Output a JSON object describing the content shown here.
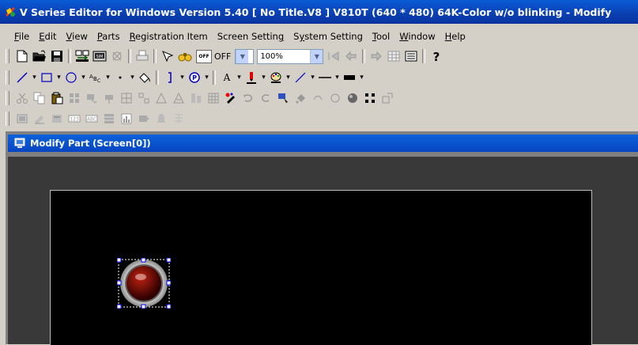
{
  "window": {
    "title": "V Series Editor for Windows Version 5.40 [ No Title.V8 ] V810T (640 * 480) 64K-Color w/o blinking - Modify"
  },
  "menu": [
    {
      "label": "File",
      "key": "F",
      "rest": "ile"
    },
    {
      "label": "Edit",
      "key": "E",
      "rest": "dit"
    },
    {
      "label": "View",
      "key": "V",
      "rest": "iew"
    },
    {
      "label": "Parts",
      "key": "P",
      "rest": "arts"
    },
    {
      "label": "Registration Item",
      "key": "R",
      "rest": "egistration Item"
    },
    {
      "label": "Screen Setting",
      "pre": "Screen Settin",
      "key": "g",
      "rest": ""
    },
    {
      "label": "System Setting",
      "pre": "S",
      "key": "y",
      "rest": "stem Setting"
    },
    {
      "label": "Tool",
      "key": "T",
      "rest": "ool"
    },
    {
      "label": "Window",
      "key": "W",
      "rest": "indow"
    },
    {
      "label": "Help",
      "key": "H",
      "rest": "elp"
    }
  ],
  "toolbar_main": {
    "off_label": "OFF",
    "off_icon_text": "OFF",
    "zoom_value": "100%"
  },
  "child_window": {
    "title": "Modify Part (Screen[0])"
  },
  "colors": {
    "titlebar": "#0a4fc8",
    "workarea": "#393939",
    "screen": "#000000",
    "selection": "#0000ff"
  }
}
